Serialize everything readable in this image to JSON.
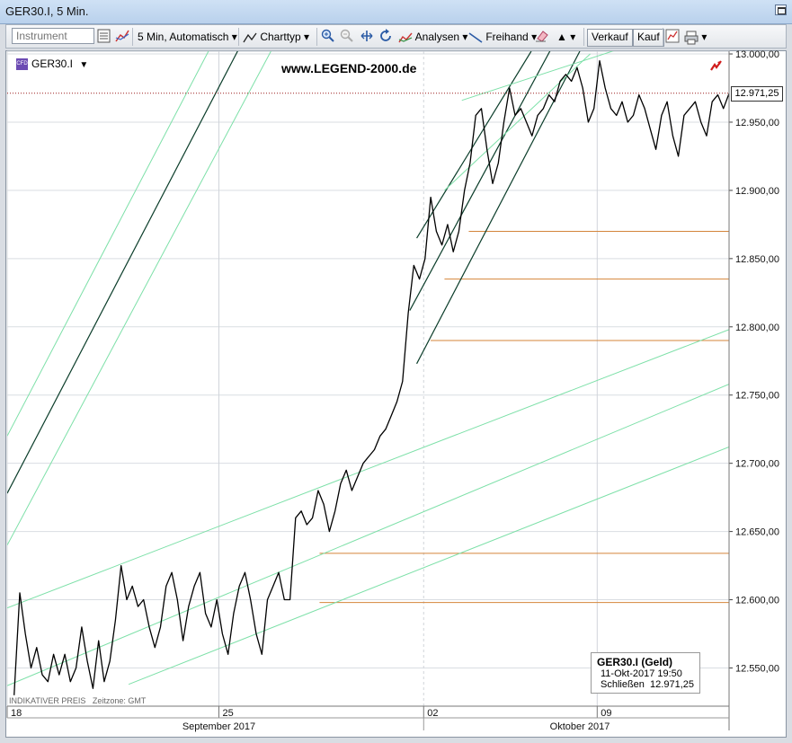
{
  "window": {
    "title": "GER30.I, 5 Min."
  },
  "toolbar": {
    "instrument_placeholder": "Instrument",
    "timeframe_label": "5 Min, Automatisch",
    "charttype_label": "Charttyp",
    "analysen_label": "Analysen",
    "freihand_label": "Freihand",
    "sell_label": "Verkauf",
    "buy_label": "Kauf"
  },
  "legend": {
    "ticker": "GER30.I",
    "icon_text": "CFD"
  },
  "watermark": "www.LEGEND-2000.de",
  "footnote": {
    "indicative": "INDIKATIVER PREIS",
    "timezone": "Zeitzone: GMT"
  },
  "info_box": {
    "title": "GER30.I (Geld)",
    "date": "11-Okt-2017 19:50",
    "close_label": "Schließen",
    "close_value": "12.971,25"
  },
  "current_price_label": "12.971,25",
  "colors": {
    "price": "#000000",
    "trend_dark": "#0b3d2a",
    "trend_light": "#7de0a8",
    "support": "#d4853a",
    "current": "#9b1b1b"
  },
  "chart_data": {
    "type": "line",
    "series": [
      {
        "values": [
          12530,
          12605,
          12575,
          12550,
          12565,
          12545,
          12540,
          12560,
          12545,
          12560,
          12540,
          12550,
          12580,
          12555,
          12535,
          12570,
          12540,
          12555,
          12585,
          12625,
          12600,
          12610,
          12595,
          12600,
          12580,
          12565,
          12580,
          12610,
          12620,
          12600,
          12570,
          12595,
          12610,
          12620,
          12590,
          12580,
          12600,
          12575,
          12560,
          12590,
          12610,
          12620,
          12600,
          12575,
          12560,
          12600,
          12610,
          12620,
          12600,
          12600,
          12660,
          12665,
          12655,
          12660,
          12680,
          12670,
          12650,
          12665,
          12685,
          12695,
          12680,
          12690,
          12700,
          12705,
          12710,
          12720,
          12725,
          12735,
          12745,
          12760,
          12810,
          12845,
          12835,
          12850,
          12895,
          12870,
          12860,
          12875,
          12855,
          12870,
          12900,
          12920,
          12955,
          12960,
          12930,
          12905,
          12920,
          12950,
          12975,
          12955,
          12960,
          12950,
          12940,
          12955,
          12960,
          12970,
          12965,
          12980,
          12985,
          12980,
          12990,
          12975,
          12950,
          12960,
          12995,
          12975,
          12960,
          12955,
          12965,
          12950,
          12955,
          12970,
          12960,
          12945,
          12930,
          12955,
          12965,
          12940,
          12925,
          12955,
          12960,
          12965,
          12950,
          12940,
          12965,
          12970,
          12960,
          12971
        ]
      }
    ],
    "x_ticks": [
      "18",
      "25",
      "02",
      "09"
    ],
    "x_tick_positions": [
      0,
      61,
      120,
      170
    ],
    "x_range": [
      0,
      208
    ],
    "month_labels": [
      "September 2017",
      "Oktober 2017"
    ],
    "month_label_positions": [
      61,
      165
    ],
    "y_ticks": [
      "13.000,00",
      "12.950,00",
      "12.900,00",
      "12.850,00",
      "12.800,00",
      "12.750,00",
      "12.700,00",
      "12.650,00",
      "12.600,00",
      "12.550,00"
    ],
    "ylim": [
      12522,
      13002
    ],
    "support_levels": [
      {
        "value": 12870,
        "from": 133
      },
      {
        "value": 12835,
        "from": 126
      },
      {
        "value": 12790,
        "from": 122
      },
      {
        "value": 12634,
        "from": 90
      },
      {
        "value": 12598,
        "from": 90
      }
    ],
    "trendlines": [
      {
        "style": "dark",
        "p1": [
          0,
          12678
        ],
        "p2": [
          67,
          13005
        ]
      },
      {
        "style": "light",
        "p1": [
          0,
          12720
        ],
        "p2": [
          58,
          13002
        ]
      },
      {
        "style": "light",
        "p1": [
          0,
          12640
        ],
        "p2": [
          76,
          13002
        ]
      },
      {
        "style": "light",
        "p1": [
          0,
          12594
        ],
        "p2": [
          208,
          12798
        ]
      },
      {
        "style": "light",
        "p1": [
          0,
          12537
        ],
        "p2": [
          208,
          12758
        ]
      },
      {
        "style": "light",
        "p1": [
          35,
          12538
        ],
        "p2": [
          208,
          12712
        ]
      },
      {
        "style": "dark",
        "p1": [
          116,
          12812
        ],
        "p2": [
          157,
          13005
        ]
      },
      {
        "style": "dark",
        "p1": [
          118,
          12773
        ],
        "p2": [
          165,
          13002
        ]
      },
      {
        "style": "dark",
        "p1": [
          118,
          12865
        ],
        "p2": [
          151,
          13002
        ]
      },
      {
        "style": "light",
        "p1": [
          131,
          12966
        ],
        "p2": [
          178,
          13005
        ]
      },
      {
        "style": "light",
        "p1": [
          126,
          12900
        ],
        "p2": [
          168,
          13000
        ]
      }
    ],
    "current_price": 12971.25,
    "grid": true
  }
}
